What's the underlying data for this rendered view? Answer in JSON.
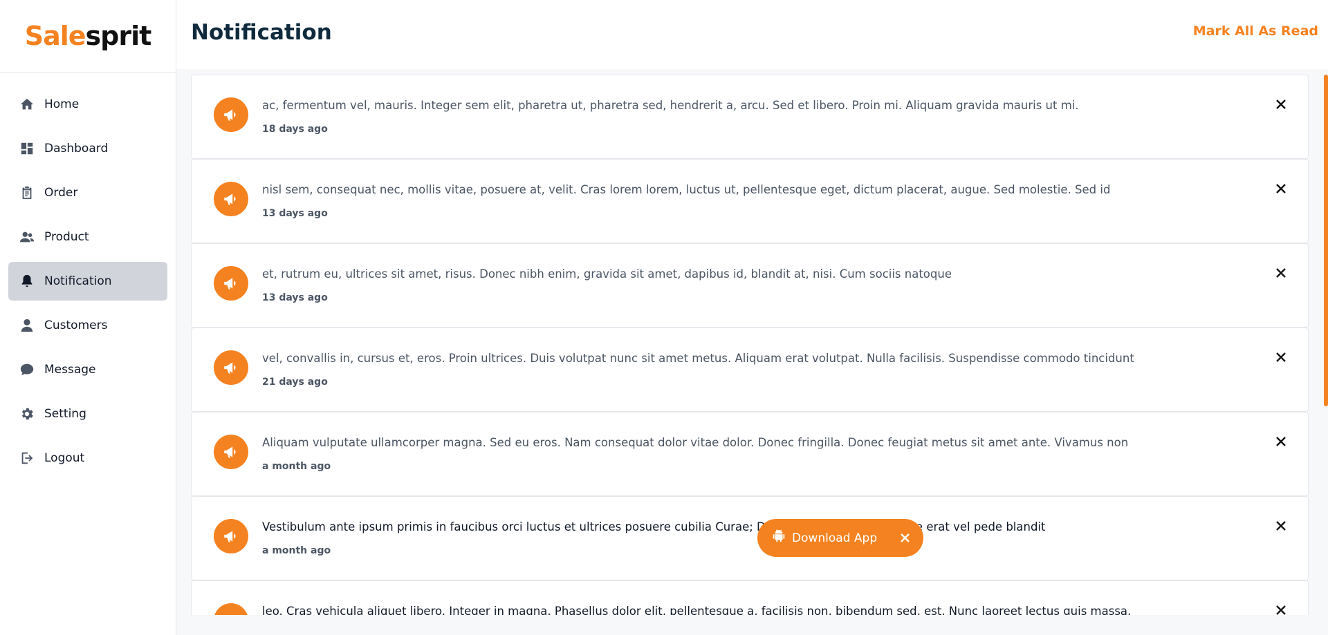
{
  "brand": {
    "part1": "Sale",
    "part2": "sprit",
    "accent_color": "#f58220"
  },
  "sidebar": {
    "items": [
      {
        "label": "Home",
        "icon": "home-icon"
      },
      {
        "label": "Dashboard",
        "icon": "dashboard-icon"
      },
      {
        "label": "Order",
        "icon": "clipboard-icon"
      },
      {
        "label": "Product",
        "icon": "users-icon"
      },
      {
        "label": "Notification",
        "icon": "bell-icon",
        "active": true
      },
      {
        "label": "Customers",
        "icon": "user-icon"
      },
      {
        "label": "Message",
        "icon": "chat-icon"
      },
      {
        "label": "Setting",
        "icon": "gear-icon"
      },
      {
        "label": "Logout",
        "icon": "logout-icon"
      }
    ]
  },
  "header": {
    "title": "Notification",
    "mark_all_label": "Mark All As Read"
  },
  "notifications": [
    {
      "text": "ac, fermentum vel, mauris. Integer sem elit, pharetra ut, pharetra sed, hendrerit a, arcu. Sed et libero. Proin mi. Aliquam gravida mauris ut mi.",
      "time": "18 days ago"
    },
    {
      "text": "nisl sem, consequat nec, mollis vitae, posuere at, velit. Cras lorem lorem, luctus ut, pellentesque eget, dictum placerat, augue. Sed molestie. Sed id",
      "time": "13 days ago"
    },
    {
      "text": "et, rutrum eu, ultrices sit amet, risus. Donec nibh enim, gravida sit amet, dapibus id, blandit at, nisi. Cum sociis natoque",
      "time": "13 days ago"
    },
    {
      "text": "vel, convallis in, cursus et, eros. Proin ultrices. Duis volutpat nunc sit amet metus. Aliquam erat volutpat. Nulla facilisis. Suspendisse commodo tincidunt",
      "time": "21 days ago"
    },
    {
      "text": "Aliquam vulputate ullamcorper magna. Sed eu eros. Nam consequat dolor vitae dolor. Donec fringilla. Donec feugiat metus sit amet ante. Vivamus non",
      "time": "a month ago"
    },
    {
      "text": "Vestibulum ante ipsum primis in faucibus orci luctus et ultrices posuere cubilia Curae; Donec tincidunt. Donec vitae erat vel pede blandit",
      "time": "a month ago"
    },
    {
      "text": "leo. Cras vehicula aliquet libero. Integer in magna. Phasellus dolor elit, pellentesque a, facilisis non, bibendum sed, est. Nunc laoreet lectus quis massa.",
      "time": ""
    }
  ],
  "download_app": {
    "label": "Download App",
    "icon": "android-icon"
  }
}
